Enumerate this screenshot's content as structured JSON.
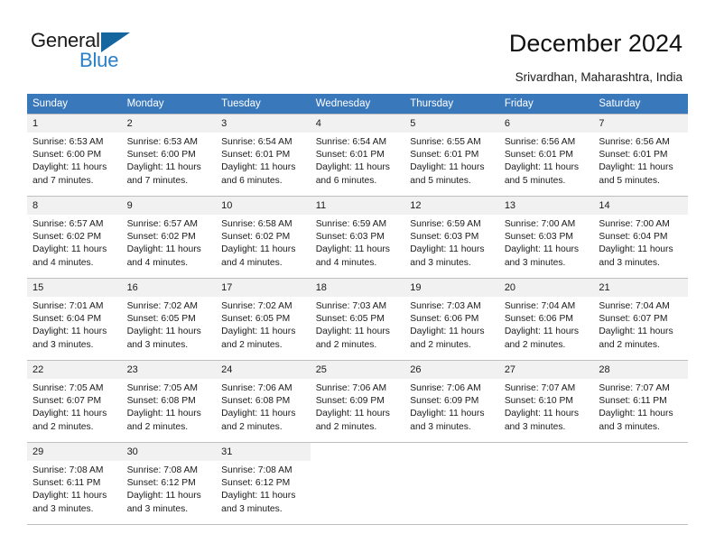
{
  "brand": {
    "name_top": "General",
    "name_bottom": "Blue",
    "accent_color": "#2a7fc9",
    "triangle_color": "#15659e"
  },
  "header": {
    "title": "December 2024",
    "subtitle": "Srivardhan, Maharashtra, India"
  },
  "theme": {
    "header_bg": "#3a78bc",
    "header_text": "#ffffff",
    "daynum_bg": "#f1f1f1",
    "grid_line": "#bfbfbf"
  },
  "weekday_headers": [
    "Sunday",
    "Monday",
    "Tuesday",
    "Wednesday",
    "Thursday",
    "Friday",
    "Saturday"
  ],
  "labels": {
    "sunrise_prefix": "Sunrise:",
    "sunset_prefix": "Sunset:",
    "daylight_prefix": "Daylight:"
  },
  "weeks": [
    [
      {
        "day": "1",
        "line1": "Sunrise: 6:53 AM",
        "line2": "Sunset: 6:00 PM",
        "line3": "Daylight: 11 hours",
        "line4": "and 7 minutes."
      },
      {
        "day": "2",
        "line1": "Sunrise: 6:53 AM",
        "line2": "Sunset: 6:00 PM",
        "line3": "Daylight: 11 hours",
        "line4": "and 7 minutes."
      },
      {
        "day": "3",
        "line1": "Sunrise: 6:54 AM",
        "line2": "Sunset: 6:01 PM",
        "line3": "Daylight: 11 hours",
        "line4": "and 6 minutes."
      },
      {
        "day": "4",
        "line1": "Sunrise: 6:54 AM",
        "line2": "Sunset: 6:01 PM",
        "line3": "Daylight: 11 hours",
        "line4": "and 6 minutes."
      },
      {
        "day": "5",
        "line1": "Sunrise: 6:55 AM",
        "line2": "Sunset: 6:01 PM",
        "line3": "Daylight: 11 hours",
        "line4": "and 5 minutes."
      },
      {
        "day": "6",
        "line1": "Sunrise: 6:56 AM",
        "line2": "Sunset: 6:01 PM",
        "line3": "Daylight: 11 hours",
        "line4": "and 5 minutes."
      },
      {
        "day": "7",
        "line1": "Sunrise: 6:56 AM",
        "line2": "Sunset: 6:01 PM",
        "line3": "Daylight: 11 hours",
        "line4": "and 5 minutes."
      }
    ],
    [
      {
        "day": "8",
        "line1": "Sunrise: 6:57 AM",
        "line2": "Sunset: 6:02 PM",
        "line3": "Daylight: 11 hours",
        "line4": "and 4 minutes."
      },
      {
        "day": "9",
        "line1": "Sunrise: 6:57 AM",
        "line2": "Sunset: 6:02 PM",
        "line3": "Daylight: 11 hours",
        "line4": "and 4 minutes."
      },
      {
        "day": "10",
        "line1": "Sunrise: 6:58 AM",
        "line2": "Sunset: 6:02 PM",
        "line3": "Daylight: 11 hours",
        "line4": "and 4 minutes."
      },
      {
        "day": "11",
        "line1": "Sunrise: 6:59 AM",
        "line2": "Sunset: 6:03 PM",
        "line3": "Daylight: 11 hours",
        "line4": "and 4 minutes."
      },
      {
        "day": "12",
        "line1": "Sunrise: 6:59 AM",
        "line2": "Sunset: 6:03 PM",
        "line3": "Daylight: 11 hours",
        "line4": "and 3 minutes."
      },
      {
        "day": "13",
        "line1": "Sunrise: 7:00 AM",
        "line2": "Sunset: 6:03 PM",
        "line3": "Daylight: 11 hours",
        "line4": "and 3 minutes."
      },
      {
        "day": "14",
        "line1": "Sunrise: 7:00 AM",
        "line2": "Sunset: 6:04 PM",
        "line3": "Daylight: 11 hours",
        "line4": "and 3 minutes."
      }
    ],
    [
      {
        "day": "15",
        "line1": "Sunrise: 7:01 AM",
        "line2": "Sunset: 6:04 PM",
        "line3": "Daylight: 11 hours",
        "line4": "and 3 minutes."
      },
      {
        "day": "16",
        "line1": "Sunrise: 7:02 AM",
        "line2": "Sunset: 6:05 PM",
        "line3": "Daylight: 11 hours",
        "line4": "and 3 minutes."
      },
      {
        "day": "17",
        "line1": "Sunrise: 7:02 AM",
        "line2": "Sunset: 6:05 PM",
        "line3": "Daylight: 11 hours",
        "line4": "and 2 minutes."
      },
      {
        "day": "18",
        "line1": "Sunrise: 7:03 AM",
        "line2": "Sunset: 6:05 PM",
        "line3": "Daylight: 11 hours",
        "line4": "and 2 minutes."
      },
      {
        "day": "19",
        "line1": "Sunrise: 7:03 AM",
        "line2": "Sunset: 6:06 PM",
        "line3": "Daylight: 11 hours",
        "line4": "and 2 minutes."
      },
      {
        "day": "20",
        "line1": "Sunrise: 7:04 AM",
        "line2": "Sunset: 6:06 PM",
        "line3": "Daylight: 11 hours",
        "line4": "and 2 minutes."
      },
      {
        "day": "21",
        "line1": "Sunrise: 7:04 AM",
        "line2": "Sunset: 6:07 PM",
        "line3": "Daylight: 11 hours",
        "line4": "and 2 minutes."
      }
    ],
    [
      {
        "day": "22",
        "line1": "Sunrise: 7:05 AM",
        "line2": "Sunset: 6:07 PM",
        "line3": "Daylight: 11 hours",
        "line4": "and 2 minutes."
      },
      {
        "day": "23",
        "line1": "Sunrise: 7:05 AM",
        "line2": "Sunset: 6:08 PM",
        "line3": "Daylight: 11 hours",
        "line4": "and 2 minutes."
      },
      {
        "day": "24",
        "line1": "Sunrise: 7:06 AM",
        "line2": "Sunset: 6:08 PM",
        "line3": "Daylight: 11 hours",
        "line4": "and 2 minutes."
      },
      {
        "day": "25",
        "line1": "Sunrise: 7:06 AM",
        "line2": "Sunset: 6:09 PM",
        "line3": "Daylight: 11 hours",
        "line4": "and 2 minutes."
      },
      {
        "day": "26",
        "line1": "Sunrise: 7:06 AM",
        "line2": "Sunset: 6:09 PM",
        "line3": "Daylight: 11 hours",
        "line4": "and 3 minutes."
      },
      {
        "day": "27",
        "line1": "Sunrise: 7:07 AM",
        "line2": "Sunset: 6:10 PM",
        "line3": "Daylight: 11 hours",
        "line4": "and 3 minutes."
      },
      {
        "day": "28",
        "line1": "Sunrise: 7:07 AM",
        "line2": "Sunset: 6:11 PM",
        "line3": "Daylight: 11 hours",
        "line4": "and 3 minutes."
      }
    ],
    [
      {
        "day": "29",
        "line1": "Sunrise: 7:08 AM",
        "line2": "Sunset: 6:11 PM",
        "line3": "Daylight: 11 hours",
        "line4": "and 3 minutes."
      },
      {
        "day": "30",
        "line1": "Sunrise: 7:08 AM",
        "line2": "Sunset: 6:12 PM",
        "line3": "Daylight: 11 hours",
        "line4": "and 3 minutes."
      },
      {
        "day": "31",
        "line1": "Sunrise: 7:08 AM",
        "line2": "Sunset: 6:12 PM",
        "line3": "Daylight: 11 hours",
        "line4": "and 3 minutes."
      },
      {
        "day": "",
        "line1": "",
        "line2": "",
        "line3": "",
        "line4": ""
      },
      {
        "day": "",
        "line1": "",
        "line2": "",
        "line3": "",
        "line4": ""
      },
      {
        "day": "",
        "line1": "",
        "line2": "",
        "line3": "",
        "line4": ""
      },
      {
        "day": "",
        "line1": "",
        "line2": "",
        "line3": "",
        "line4": ""
      }
    ]
  ]
}
